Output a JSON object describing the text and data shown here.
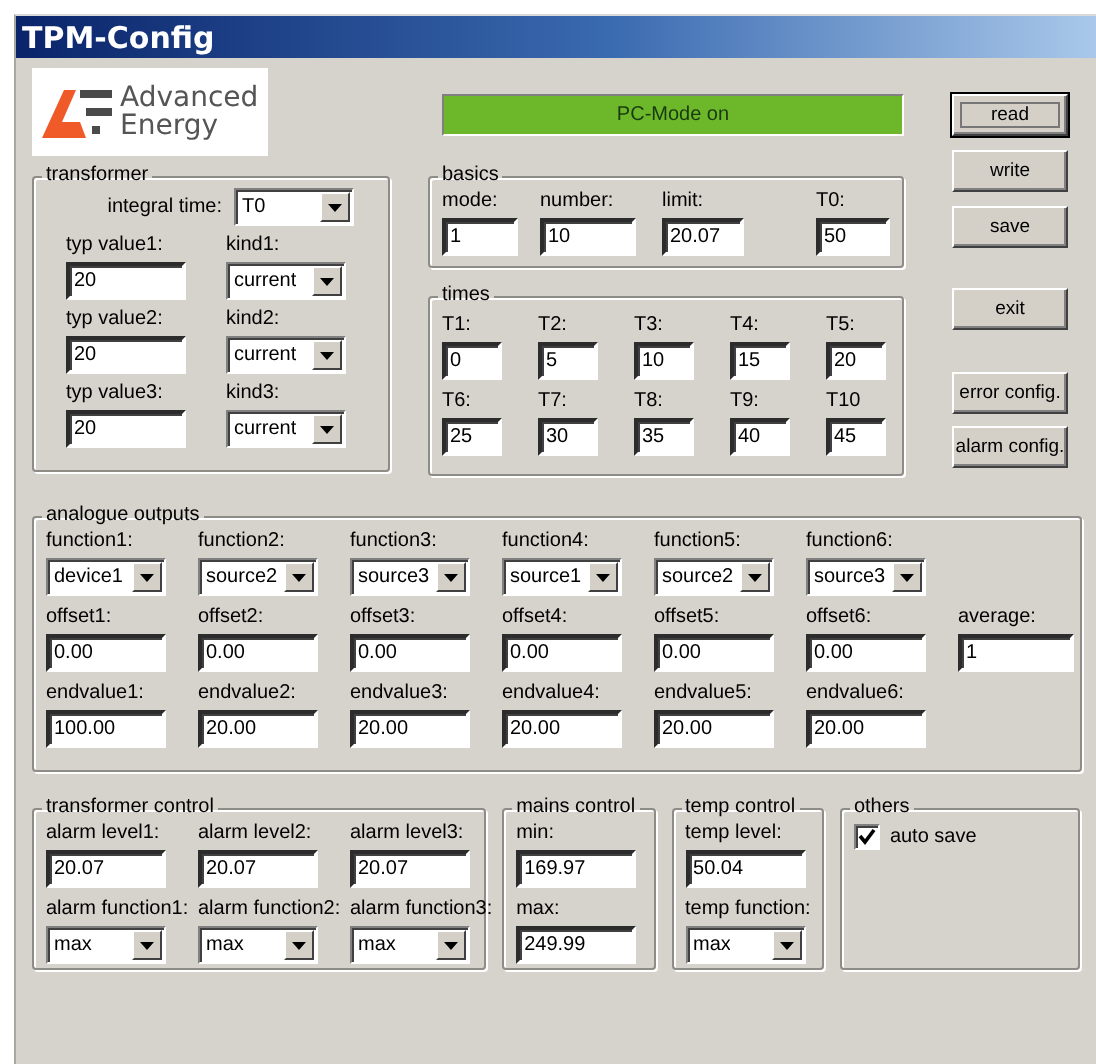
{
  "window": {
    "title": "TPM-Config"
  },
  "logo": {
    "line1": "Advanced",
    "line2": "Energy"
  },
  "status_indicator": {
    "label": "PC-Mode on",
    "on": true
  },
  "transformer": {
    "title": "transformer",
    "integral_time": {
      "label": "integral time:",
      "value": "T0"
    },
    "rows": [
      {
        "typ_label": "typ value1:",
        "typ_value": "20",
        "kind_label": "kind1:",
        "kind_value": "current"
      },
      {
        "typ_label": "typ value2:",
        "typ_value": "20",
        "kind_label": "kind2:",
        "kind_value": "current"
      },
      {
        "typ_label": "typ value3:",
        "typ_value": "20",
        "kind_label": "kind3:",
        "kind_value": "current"
      }
    ]
  },
  "basics": {
    "title": "basics",
    "fields": [
      {
        "label": "mode:",
        "value": "1"
      },
      {
        "label": "number:",
        "value": "10"
      },
      {
        "label": "limit:",
        "value": "20.07"
      },
      {
        "label": "T0:",
        "value": "50"
      }
    ]
  },
  "times": {
    "title": "times",
    "fields": [
      {
        "label": "T1:",
        "value": "0"
      },
      {
        "label": "T2:",
        "value": "5"
      },
      {
        "label": "T3:",
        "value": "10"
      },
      {
        "label": "T4:",
        "value": "15"
      },
      {
        "label": "T5:",
        "value": "20"
      },
      {
        "label": "T6:",
        "value": "25"
      },
      {
        "label": "T7:",
        "value": "30"
      },
      {
        "label": "T8:",
        "value": "35"
      },
      {
        "label": "T9:",
        "value": "40"
      },
      {
        "label": "T10",
        "value": "45"
      }
    ]
  },
  "buttons": [
    {
      "label": "read",
      "focused": true
    },
    {
      "label": "write",
      "focused": false
    },
    {
      "label": "save",
      "focused": false
    },
    {
      "label": "exit",
      "focused": false
    },
    {
      "label": "error config.",
      "focused": false
    },
    {
      "label": "alarm config.",
      "focused": false
    }
  ],
  "analogue_outputs": {
    "title": "analogue outputs",
    "functions": [
      {
        "label": "function1:",
        "value": "device1"
      },
      {
        "label": "function2:",
        "value": "source2"
      },
      {
        "label": "function3:",
        "value": "source3"
      },
      {
        "label": "function4:",
        "value": "source1"
      },
      {
        "label": "function5:",
        "value": "source2"
      },
      {
        "label": "function6:",
        "value": "source3"
      }
    ],
    "offsets": [
      {
        "label": "offset1:",
        "value": "0.00"
      },
      {
        "label": "offset2:",
        "value": "0.00"
      },
      {
        "label": "offset3:",
        "value": "0.00"
      },
      {
        "label": "offset4:",
        "value": "0.00"
      },
      {
        "label": "offset5:",
        "value": "0.00"
      },
      {
        "label": "offset6:",
        "value": "0.00"
      }
    ],
    "average": {
      "label": "average:",
      "value": "1"
    },
    "endvalues": [
      {
        "label": "endvalue1:",
        "value": "100.00"
      },
      {
        "label": "endvalue2:",
        "value": "20.00"
      },
      {
        "label": "endvalue3:",
        "value": "20.00"
      },
      {
        "label": "endvalue4:",
        "value": "20.00"
      },
      {
        "label": "endvalue5:",
        "value": "20.00"
      },
      {
        "label": "endvalue6:",
        "value": "20.00"
      }
    ]
  },
  "transformer_control": {
    "title": "transformer control",
    "alarm_levels": [
      {
        "label": "alarm level1:",
        "value": "20.07"
      },
      {
        "label": "alarm level2:",
        "value": "20.07"
      },
      {
        "label": "alarm level3:",
        "value": "20.07"
      }
    ],
    "alarm_functions": [
      {
        "label": "alarm function1:",
        "value": "max"
      },
      {
        "label": "alarm function2:",
        "value": "max"
      },
      {
        "label": "alarm function3:",
        "value": "max"
      }
    ]
  },
  "mains_control": {
    "title": "mains control",
    "fields": [
      {
        "label": "min:",
        "value": "169.97"
      },
      {
        "label": "max:",
        "value": "249.99"
      }
    ]
  },
  "temp_control": {
    "title": "temp control",
    "level": {
      "label": "temp level:",
      "value": "50.04"
    },
    "function": {
      "label": "temp function:",
      "value": "max"
    }
  },
  "others": {
    "title": "others",
    "checkboxes": [
      {
        "label": "auto save",
        "checked": true
      }
    ]
  }
}
